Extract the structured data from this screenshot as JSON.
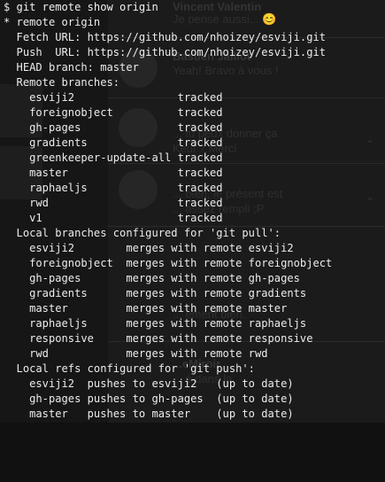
{
  "background_app": {
    "messages": [
      {
        "name": "Vincent Valentin",
        "text": "Je pense aussi... 😊"
      },
      {
        "name": "Bastien Jaillot",
        "text": "Yeah! Bravo à vous !"
      },
      {
        "name": "",
        "text": "... tu peux donner ça"
      },
      {
        "name": "",
        "text": "Keul ? Merci"
      },
      {
        "name": "",
        "text": "... bien, le présent est"
      },
      {
        "name": "",
        "text": "... assez rempli ;P"
      },
      {
        "name": "",
        "text": "... ement bien."
      },
      {
        "name": "...eMiroir",
        "text": "... é dans la"
      }
    ]
  },
  "terminal": {
    "prompt_symbol": "$",
    "command": "git remote show origin",
    "remote_header": "* remote origin",
    "fetch_url_label": "Fetch URL:",
    "fetch_url": "https://github.com/nhoizey/esviji.git",
    "push_url_label": "Push  URL:",
    "push_url": "https://github.com/nhoizey/esviji.git",
    "head_branch_label": "HEAD branch:",
    "head_branch": "master",
    "remote_branches_header": "Remote branches:",
    "remote_branches": [
      {
        "name": "esviji2",
        "status": "tracked"
      },
      {
        "name": "foreignobject",
        "status": "tracked"
      },
      {
        "name": "gh-pages",
        "status": "tracked"
      },
      {
        "name": "gradients",
        "status": "tracked"
      },
      {
        "name": "greenkeeper-update-all",
        "status": "tracked"
      },
      {
        "name": "master",
        "status": "tracked"
      },
      {
        "name": "raphaeljs",
        "status": "tracked"
      },
      {
        "name": "rwd",
        "status": "tracked"
      },
      {
        "name": "v1",
        "status": "tracked"
      }
    ],
    "local_pull_header": "Local branches configured for 'git pull':",
    "local_pull": [
      {
        "name": "esviji2",
        "action": "merges with remote esviji2"
      },
      {
        "name": "foreignobject",
        "action": "merges with remote foreignobject"
      },
      {
        "name": "gh-pages",
        "action": "merges with remote gh-pages"
      },
      {
        "name": "gradients",
        "action": "merges with remote gradients"
      },
      {
        "name": "master",
        "action": "merges with remote master"
      },
      {
        "name": "raphaeljs",
        "action": "merges with remote raphaeljs"
      },
      {
        "name": "responsive",
        "action": "merges with remote responsive"
      },
      {
        "name": "rwd",
        "action": "merges with remote rwd"
      }
    ],
    "local_push_header": "Local refs configured for 'git push':",
    "local_push": [
      {
        "name": "esviji2",
        "action": "pushes to esviji2",
        "status": "(up to date)"
      },
      {
        "name": "gh-pages",
        "action": "pushes to gh-pages",
        "status": "(up to date)"
      },
      {
        "name": "master",
        "action": "pushes to master",
        "status": "(up to date)"
      }
    ]
  }
}
